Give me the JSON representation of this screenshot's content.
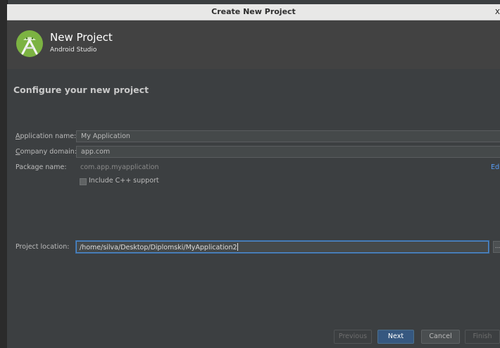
{
  "window": {
    "title": "Create New Project",
    "close_glyph": "x"
  },
  "header": {
    "title": "New Project",
    "subtitle": "Android Studio",
    "logo_icon": "android-studio-logo-icon"
  },
  "section_title": "Configure your new project",
  "form": {
    "app_name": {
      "label_prefix": "A",
      "label_rest": "pplication name:",
      "value": "My Application"
    },
    "company_domain": {
      "label_prefix": "C",
      "label_rest": "ompany domain:",
      "value": "app.com"
    },
    "package_name": {
      "label": "Package name:",
      "value": "com.app.myapplication",
      "edit_link": "Edi"
    },
    "cpp_support": {
      "label": "Include C++ support",
      "checked": false
    },
    "project_location": {
      "label": "Project location:",
      "value": "/home/silva/Desktop/Diplomski/MyApplication2",
      "browse_label": "..."
    }
  },
  "buttons": {
    "previous": "Previous",
    "next": "Next",
    "cancel": "Cancel",
    "finish": "Finish"
  },
  "colors": {
    "accent": "#365880",
    "link": "#589df6",
    "background": "#3c3f41",
    "header": "#424242"
  }
}
